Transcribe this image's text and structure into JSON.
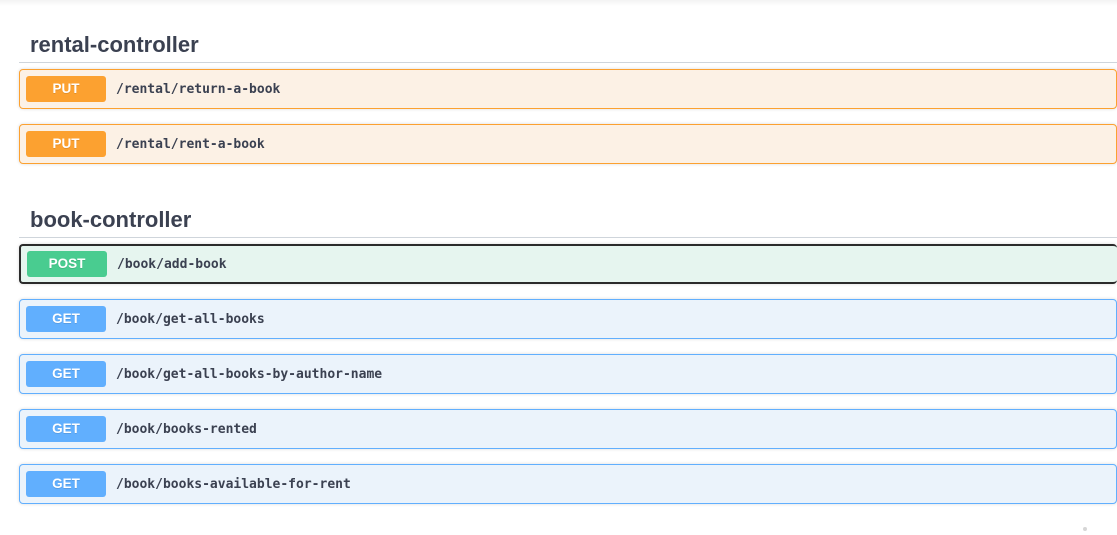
{
  "sections": [
    {
      "title": "rental-controller",
      "operations": [
        {
          "method": "PUT",
          "path": "/rental/return-a-book"
        },
        {
          "method": "PUT",
          "path": "/rental/rent-a-book"
        }
      ]
    },
    {
      "title": "book-controller",
      "operations": [
        {
          "method": "POST",
          "path": "/book/add-book"
        },
        {
          "method": "GET",
          "path": "/book/get-all-books"
        },
        {
          "method": "GET",
          "path": "/book/get-all-books-by-author-name"
        },
        {
          "method": "GET",
          "path": "/book/books-rented"
        },
        {
          "method": "GET",
          "path": "/book/books-available-for-rent"
        }
      ]
    }
  ],
  "colors": {
    "put": "#fca130",
    "post": "#49cc90",
    "get": "#61affe",
    "text": "#3b4151"
  }
}
